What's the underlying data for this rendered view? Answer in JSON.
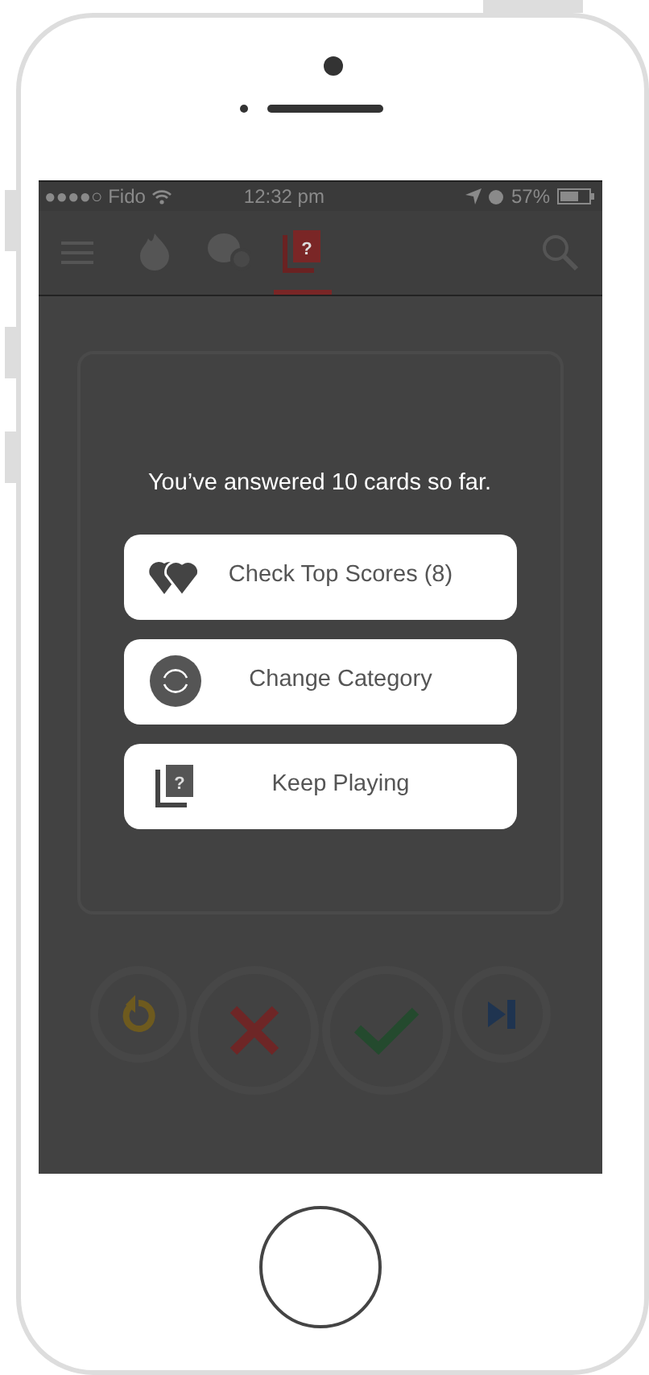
{
  "status_bar": {
    "carrier": "●●●●○ Fido",
    "time": "12:32 pm",
    "battery": "57%"
  },
  "nav_tabs": [
    {
      "kind": "flame",
      "selected": false
    },
    {
      "kind": "chat",
      "selected": false
    },
    {
      "kind": "cards",
      "selected": true,
      "glyph": "?"
    }
  ],
  "dialog": {
    "message": "You’ve answered 10 cards so far.",
    "buttons": [
      {
        "kind": "hearts",
        "label": "Check Top Scores (8)"
      },
      {
        "kind": "refresh",
        "label": "Change Category"
      },
      {
        "kind": "cards",
        "label": "Keep Playing",
        "glyph": "?"
      }
    ]
  },
  "actions": [
    {
      "kind": "undo"
    },
    {
      "kind": "no"
    },
    {
      "kind": "yes"
    },
    {
      "kind": "skip"
    }
  ]
}
